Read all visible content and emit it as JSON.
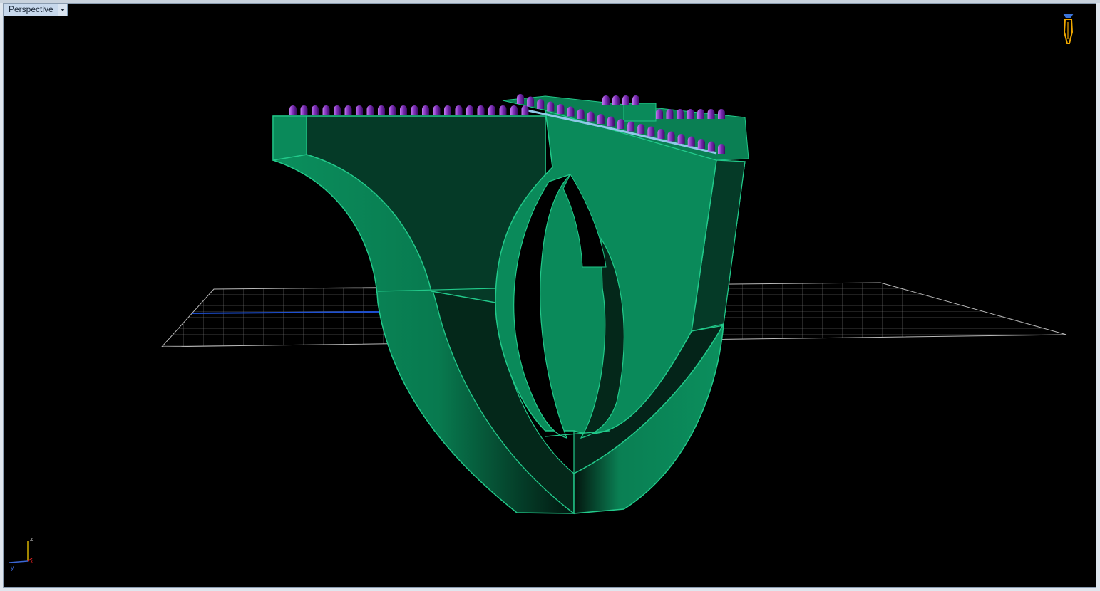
{
  "viewport": {
    "name": "Perspective",
    "background": "#000000"
  },
  "model": {
    "body_color": "#0a8a5a",
    "dark_color": "#033322",
    "edge_color": "#22c98a",
    "gem_color": "#7a2bb4",
    "setting_color": "#8fc9e8"
  },
  "grid": {
    "color": "#9a9a9a",
    "x_axis_color": "#1d4fd1",
    "y_axis_color": "#c81e1e"
  },
  "axis_indicator": {
    "z": "z",
    "y": "y",
    "x": "x"
  },
  "icons": {
    "gumball": "perspective-lock-icon"
  }
}
